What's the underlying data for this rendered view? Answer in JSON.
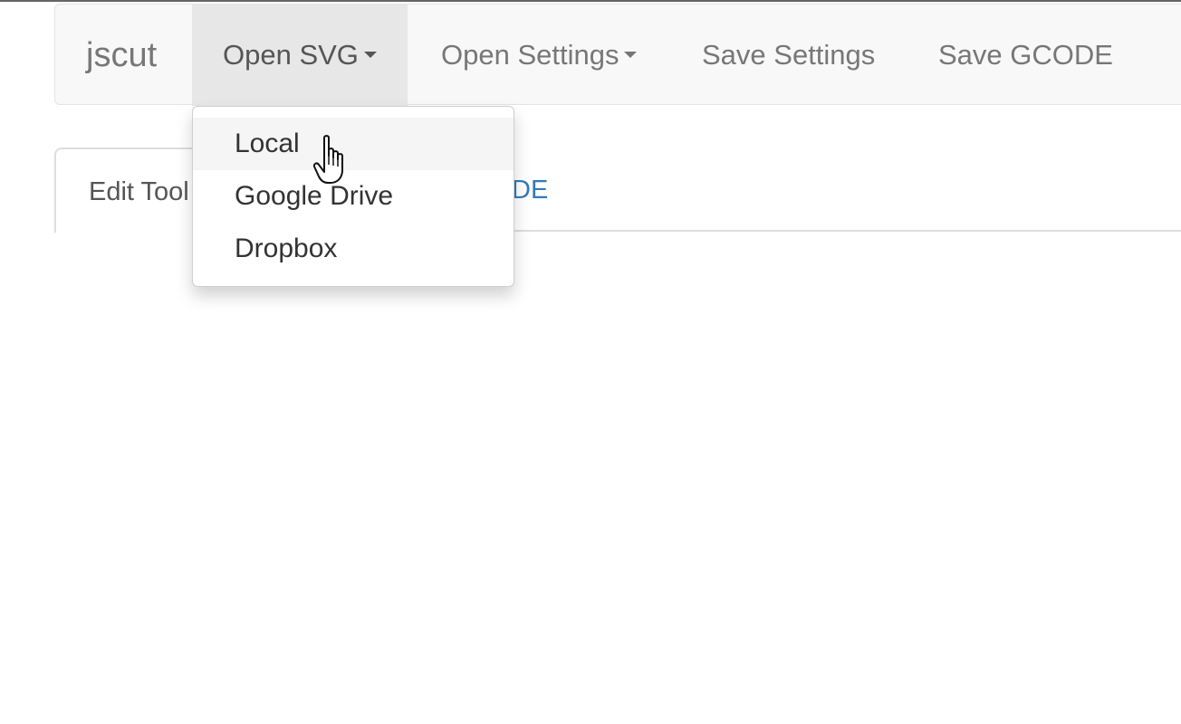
{
  "app": {
    "brand": "jscut"
  },
  "navbar": {
    "items": [
      {
        "label": "Open SVG",
        "has_caret": true,
        "open": true
      },
      {
        "label": "Open Settings",
        "has_caret": true,
        "open": false
      },
      {
        "label": "Save Settings",
        "has_caret": false,
        "open": false
      },
      {
        "label": "Save GCODE",
        "has_caret": false,
        "open": false
      }
    ]
  },
  "tabs": {
    "items": [
      {
        "label": "Edit Tool",
        "active": true
      },
      {
        "label": "DE",
        "active": false
      }
    ]
  },
  "open_svg_menu": {
    "items": [
      {
        "label": "Local",
        "hovered": true
      },
      {
        "label": "Google Drive",
        "hovered": false
      },
      {
        "label": "Dropbox",
        "hovered": false
      }
    ]
  },
  "colors": {
    "navbar_bg": "#f8f8f8",
    "nav_open_bg": "#e7e7e7",
    "link_blue": "#337ab7",
    "muted_text": "#777777"
  },
  "icons": {
    "caret": "caret-down-icon",
    "cursor": "hand-pointer-icon"
  }
}
